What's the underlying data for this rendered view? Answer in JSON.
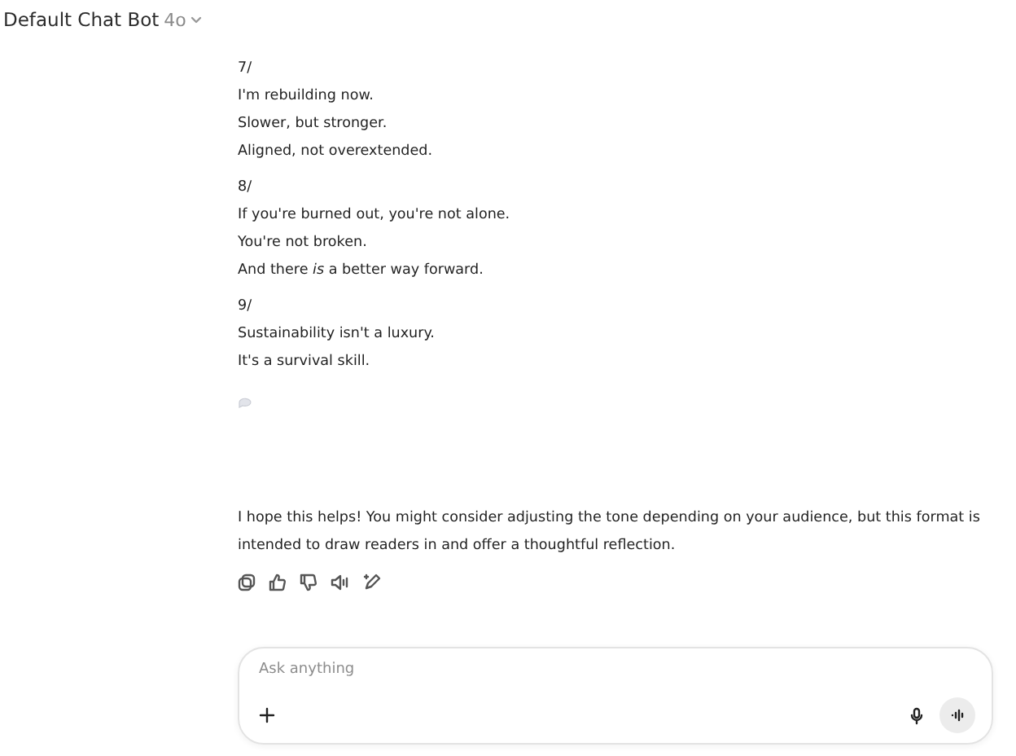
{
  "header": {
    "title": "Default Chat Bot",
    "model": "4o"
  },
  "message": {
    "sections": [
      {
        "number": "7/",
        "lines": [
          "I'm rebuilding now.",
          "Slower, but stronger.",
          "Aligned, not overextended."
        ]
      },
      {
        "number": "8/",
        "lines": [
          "If you're burned out, you're not alone.",
          "You're not broken.",
          "And there *is* a better way forward."
        ]
      },
      {
        "number": "9/",
        "lines": [
          "Sustainability isn't a luxury.",
          "It's a survival skill."
        ]
      }
    ],
    "closing": "I hope this helps! You might consider adjusting the tone depending on your audience, but this format is intended to draw readers in and offer a thoughtful reflection."
  },
  "composer": {
    "placeholder": "Ask anything"
  }
}
